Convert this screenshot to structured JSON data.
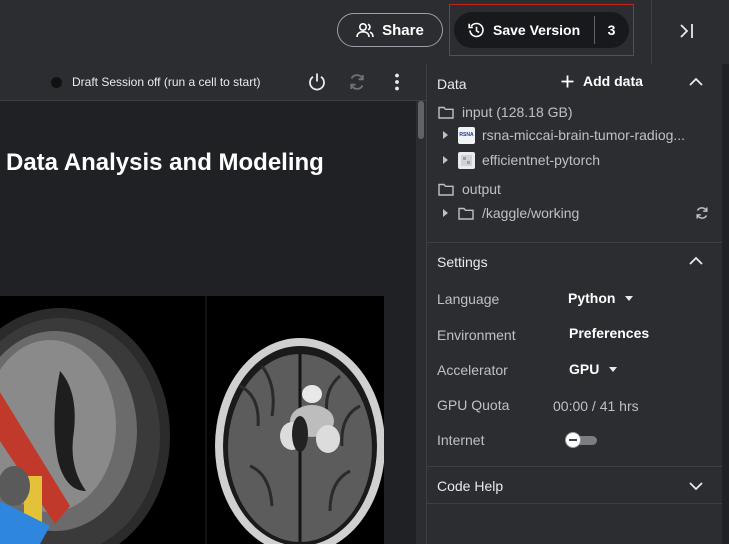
{
  "header": {
    "share_label": "Share",
    "save_version_label": "Save Version",
    "save_version_count": "3",
    "icons": [
      "people-icon",
      "version-history-icon",
      "collapse-panel-icon"
    ]
  },
  "notebook": {
    "status_text": "Draft Session off (run a cell to start)",
    "title": "Data Analysis and Modeling",
    "icons": [
      "power-icon",
      "restart-icon",
      "more-vert-icon"
    ]
  },
  "panel": {
    "data": {
      "heading": "Data",
      "add_label": "Add data",
      "input_label": "input (128.18 GB)",
      "datasets": [
        {
          "label": "rsna-miccai-brain-tumor-radiog...",
          "thumb_text": "RSNA"
        },
        {
          "label": "efficientnet-pytorch"
        }
      ],
      "output_label": "output",
      "output_items": [
        {
          "label": "/kaggle/working"
        }
      ]
    },
    "settings": {
      "heading": "Settings",
      "language_label": "Language",
      "language_value": "Python",
      "environment_label": "Environment",
      "environment_value": "Preferences",
      "accelerator_label": "Accelerator",
      "accelerator_value": "GPU",
      "gpu_quota_label": "GPU Quota",
      "gpu_quota_value": "00:00 / 41 hrs",
      "internet_label": "Internet",
      "internet_enabled": false
    },
    "code_help": {
      "heading": "Code Help"
    }
  },
  "colors": {
    "highlight_border": "#c5221f",
    "panel_bg": "#2b2d31",
    "page_bg": "#202124"
  }
}
